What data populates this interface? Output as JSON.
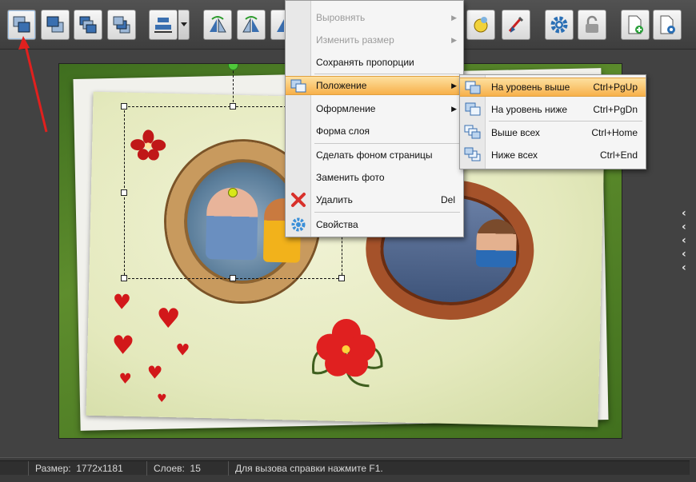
{
  "toolbar": {
    "buttons": [
      {
        "name": "bring-front",
        "icon": "layers-front-icon"
      },
      {
        "name": "send-back",
        "icon": "layers-back-icon"
      },
      {
        "name": "bring-forward",
        "icon": "layers-up-icon"
      },
      {
        "name": "send-backward",
        "icon": "layers-down-icon"
      },
      {
        "name": "align",
        "icon": "align-icon"
      },
      {
        "name": "flip-horizontal",
        "icon": "flip-h-icon"
      },
      {
        "name": "flip-vertical",
        "icon": "flip-v-icon"
      },
      {
        "name": "effects",
        "icon": "brush-icon"
      },
      {
        "name": "settings",
        "icon": "gear-icon"
      },
      {
        "name": "lock",
        "icon": "lock-icon"
      },
      {
        "name": "add-page",
        "icon": "add-page-icon"
      },
      {
        "name": "page-settings",
        "icon": "page-gear-icon"
      }
    ]
  },
  "context_menu": {
    "items": [
      {
        "label": "Выровнять",
        "disabled": true,
        "submenu": true
      },
      {
        "label": "Изменить размер",
        "disabled": true,
        "submenu": true
      },
      {
        "label": "Сохранять пропорции",
        "disabled": false
      },
      {
        "label": "Положение",
        "highlighted": true,
        "submenu": true
      },
      {
        "label": "Оформление",
        "submenu": true
      },
      {
        "label": "Форма слоя"
      },
      {
        "label": "Сделать фоном страницы"
      },
      {
        "label": "Заменить фото"
      },
      {
        "label": "Удалить",
        "shortcut": "Del"
      },
      {
        "label": "Свойства"
      }
    ]
  },
  "submenu": {
    "items": [
      {
        "label": "На уровень выше",
        "shortcut": "Ctrl+PgUp",
        "highlighted": true
      },
      {
        "label": "На уровень ниже",
        "shortcut": "Ctrl+PgDn"
      },
      {
        "label": "Выше всех",
        "shortcut": "Ctrl+Home"
      },
      {
        "label": "Ниже всех",
        "shortcut": "Ctrl+End"
      }
    ]
  },
  "statusbar": {
    "size_label": "Размер:",
    "size_value": "1772x1181",
    "layers_label": "Слоев:",
    "layers_value": "15",
    "hint": "Для вызова справки нажмите F1."
  },
  "colors": {
    "highlight": "#f7b04a",
    "accent_arrow": "#e0201e"
  }
}
